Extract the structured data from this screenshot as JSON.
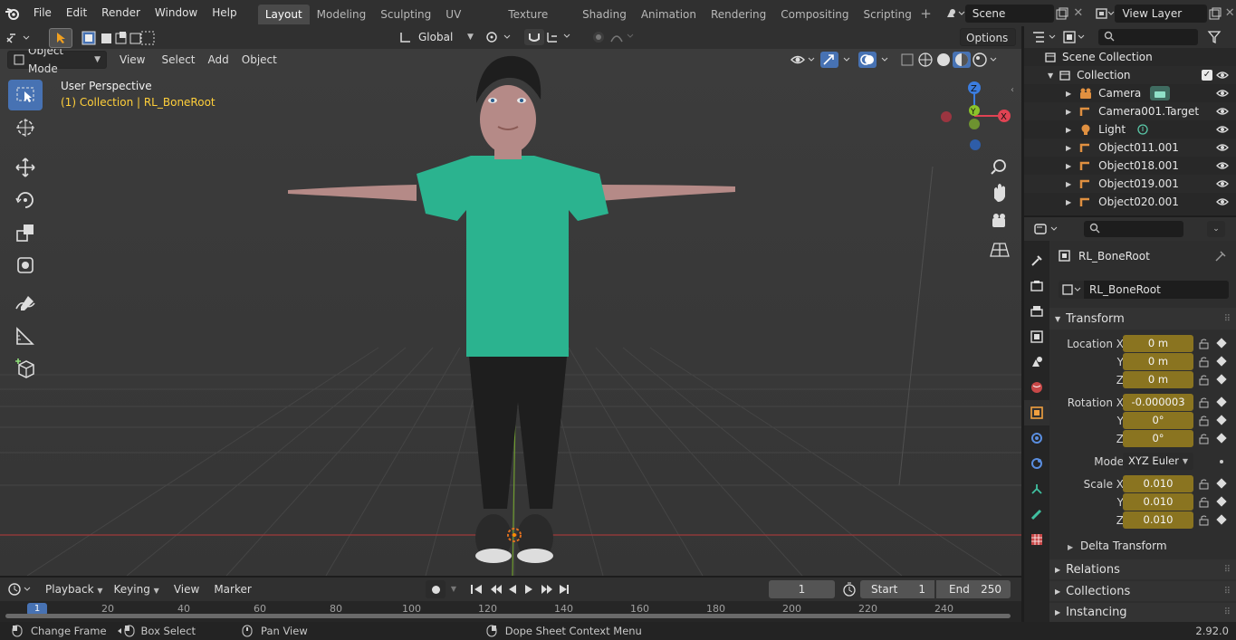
{
  "menus": [
    "File",
    "Edit",
    "Render",
    "Window",
    "Help"
  ],
  "workspaces": [
    "Layout",
    "Modeling",
    "Sculpting",
    "UV Editing",
    "Texture Paint",
    "Shading",
    "Animation",
    "Rendering",
    "Compositing",
    "Scripting"
  ],
  "active_workspace": "Layout",
  "scene": {
    "label": "Scene",
    "view_layer": "View Layer"
  },
  "viewport": {
    "orientation": "Global",
    "options": "Options",
    "mode": "Object Mode",
    "menu": [
      "View",
      "Select",
      "Add",
      "Object"
    ],
    "info_title": "User Perspective",
    "info_sub": "(1) Collection | RL_BoneRoot",
    "gizmo": {
      "z": "Z",
      "y": "Y",
      "x": "X"
    }
  },
  "outliner": {
    "root": "Scene Collection",
    "collection": "Collection",
    "items": [
      "Camera",
      "Camera001.Target",
      "Light",
      "Object011.001",
      "Object018.001",
      "Object019.001",
      "Object020.001"
    ]
  },
  "properties": {
    "object_name": "RL_BoneRoot",
    "data_name": "RL_BoneRoot",
    "transform_header": "Transform",
    "location": {
      "label": "Location X",
      "x": "0 m",
      "y": "0 m",
      "z": "0 m"
    },
    "rotation": {
      "label": "Rotation X",
      "x": "-0.000003",
      "y": "0°",
      "z": "0°"
    },
    "mode_label": "Mode",
    "mode_value": "XYZ Euler",
    "scale": {
      "label": "Scale X",
      "x": "0.010",
      "y": "0.010",
      "z": "0.010"
    },
    "axis_y": "Y",
    "axis_z": "Z",
    "delta": "Delta Transform",
    "sections": [
      "Relations",
      "Collections",
      "Instancing"
    ]
  },
  "timeline": {
    "menus": [
      "Playback",
      "Keying",
      "View",
      "Marker"
    ],
    "current_frame": "1",
    "start_label": "Start",
    "start": "1",
    "end_label": "End",
    "end": "250",
    "ticks": [
      "1",
      "20",
      "40",
      "60",
      "80",
      "100",
      "120",
      "140",
      "160",
      "180",
      "200",
      "220",
      "240"
    ]
  },
  "status": {
    "change_frame": "Change Frame",
    "box_select": "Box Select",
    "pan_view": "Pan View",
    "context_menu": "Dope Sheet Context Menu",
    "version": "2.92.0"
  },
  "colors": {
    "accent": "#4772b3",
    "field_yellow": "#8a7420",
    "shirt": "#2bb38f",
    "axis_red": "#e04353",
    "axis_green": "#8bc42a",
    "axis_blue": "#3b7de0"
  }
}
